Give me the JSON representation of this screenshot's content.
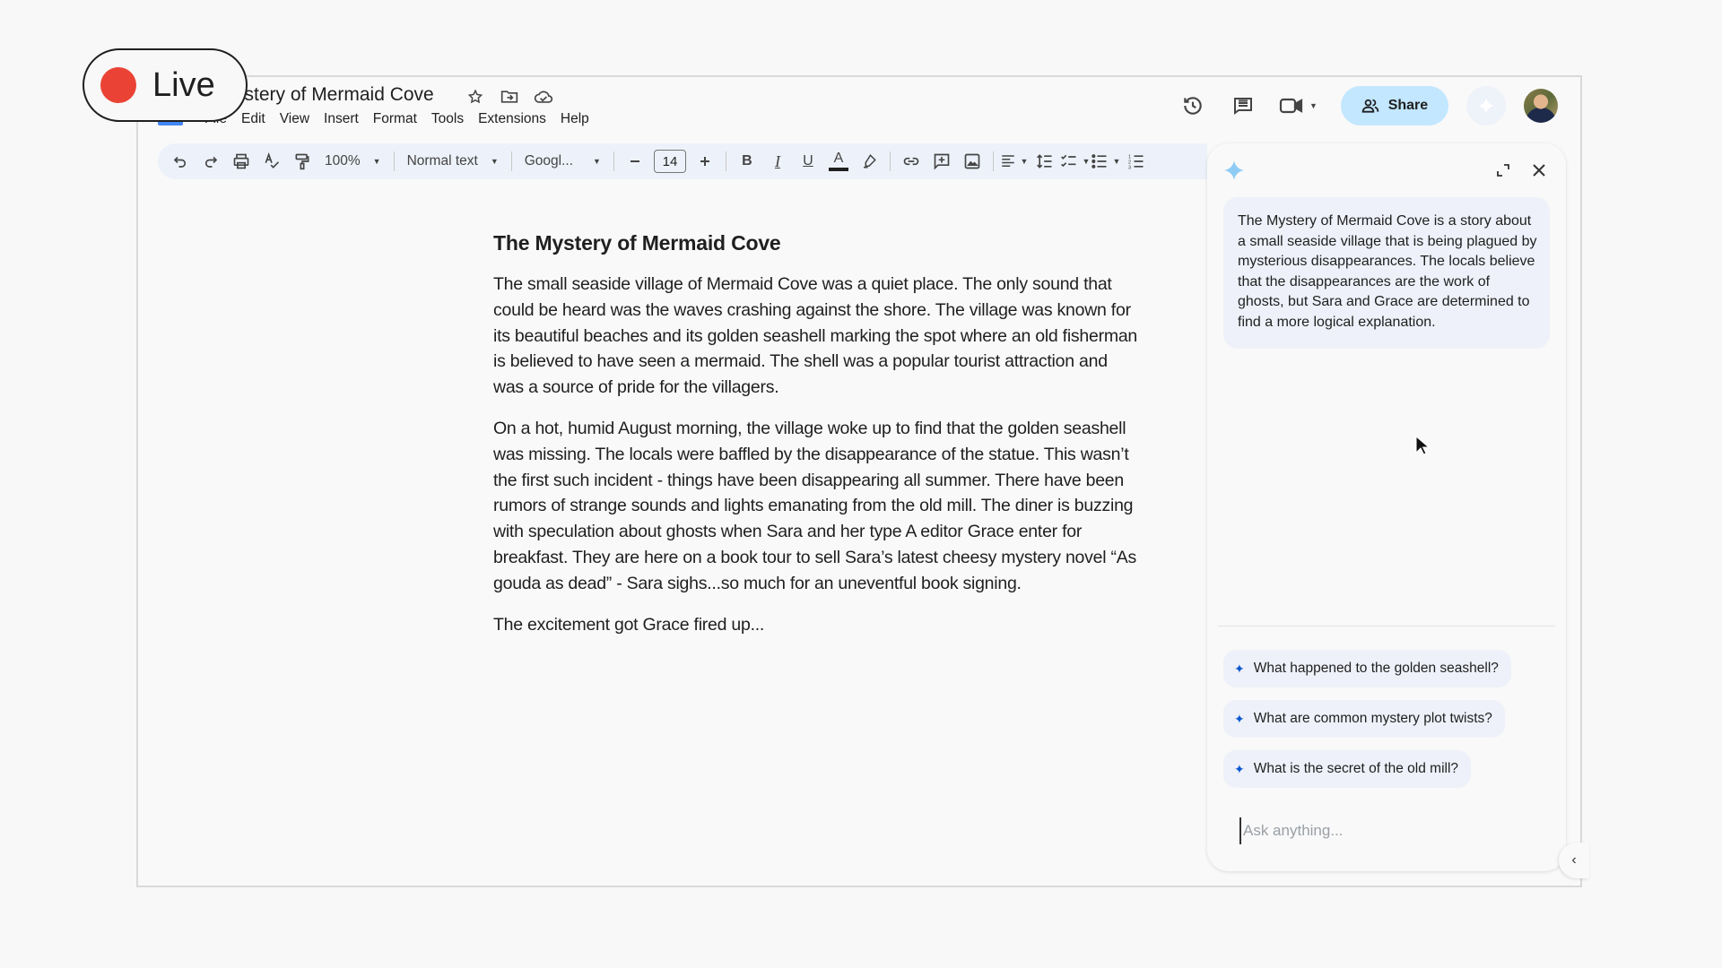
{
  "live_badge": {
    "label": "Live",
    "color": "#ea4335"
  },
  "header": {
    "title": "The Mystery of Mermaid Cove",
    "title_visible": "ystery of Mermaid Cove",
    "title_icons": [
      "star-icon",
      "move-to-folder-icon",
      "cloud-saved-icon"
    ],
    "menu": [
      "File",
      "Edit",
      "View",
      "Insert",
      "Format",
      "Tools",
      "Extensions",
      "Help"
    ],
    "right_icons": [
      "version-history-icon",
      "comments-icon",
      "meet-icon"
    ],
    "share_label": "Share",
    "share_color": "#c2e7ff"
  },
  "toolbar": {
    "zoom": "100%",
    "style": "Normal text",
    "font": "Googl...",
    "font_size": "14",
    "text_color_bar": "#1f1f1f"
  },
  "document": {
    "heading": "The Mystery of Mermaid Cove",
    "paragraphs": [
      "The small seaside village of Mermaid Cove was a quiet place. The only sound that could be heard was the waves crashing against the shore. The village was known for its beautiful beaches and its golden seashell marking the spot where an old fisherman is believed to have seen a mermaid. The shell was a popular tourist attraction and was a source of pride for the villagers.",
      "On a hot, humid August morning, the village woke up to find that the golden seashell was missing. The locals were baffled by the disappearance of the statue. This wasn’t the first such incident - things have been disappearing all summer. There have been rumors of strange sounds and lights emanating from the old mill. The diner is buzzing with speculation about ghosts when Sara and her type A editor Grace enter for breakfast. They are here on a book tour to sell Sara’s latest cheesy mystery novel “As gouda as dead” - Sara sighs...so much for an uneventful book signing.",
      "The excitement got Grace fired up..."
    ]
  },
  "side_panel": {
    "summary": "The Mystery of Mermaid Cove is a story about a small seaside village that is being plagued by mysterious disappearances. The locals believe that the disappearances are the work of ghosts, but Sara and Grace are determined to find a more logical explanation.",
    "suggestions": [
      "What happened to the golden seashell?",
      "What are common mystery plot twists?",
      "What is the secret of the old mill?"
    ],
    "input_placeholder": "Ask anything...",
    "accent": "#0b57d0"
  }
}
